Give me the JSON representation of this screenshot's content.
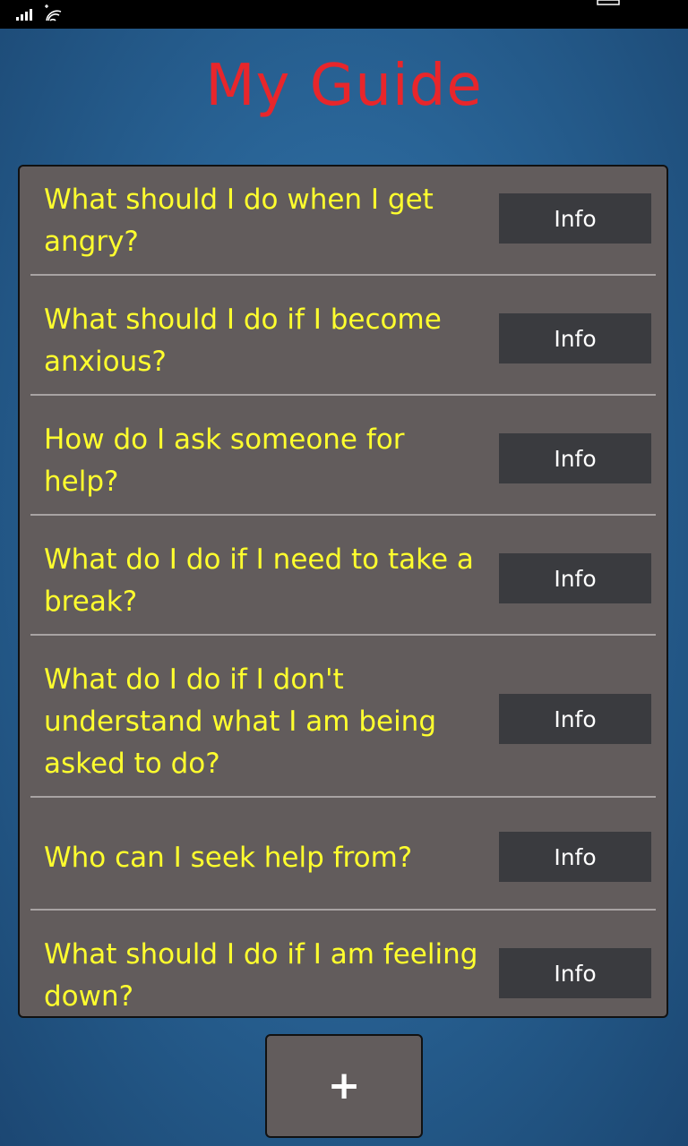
{
  "status_bar": {
    "icons": [
      "signal-icon",
      "wifi-icon",
      "battery-icon"
    ]
  },
  "app": {
    "title": "My Guide",
    "title_color": "#e8262b"
  },
  "guide": {
    "items": [
      {
        "question": "What should I do when I get angry?",
        "button_label": "Info"
      },
      {
        "question": "What should I do if I become anxious?",
        "button_label": "Info"
      },
      {
        "question": "How do I ask someone for help?",
        "button_label": "Info"
      },
      {
        "question": "What do I do if I need to take a break?",
        "button_label": "Info"
      },
      {
        "question": "What do I do if I don't understand what I am being asked to do?",
        "button_label": "Info"
      },
      {
        "question": "Who can I seek help from?",
        "button_label": "Info"
      },
      {
        "question": "What should I do if I am feeling down?",
        "button_label": "Info"
      }
    ]
  },
  "add_button": {
    "label": "+",
    "icon": "plus-icon"
  },
  "colors": {
    "question_text": "#ffff2e",
    "panel": "#625c5c",
    "button": "#3a3b3f"
  }
}
